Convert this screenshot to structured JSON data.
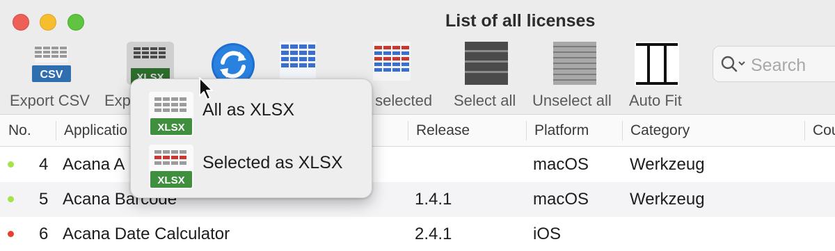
{
  "window": {
    "title": "List of all licenses"
  },
  "toolbar": {
    "export_csv": {
      "label": "Export CSV",
      "badge": "CSV"
    },
    "export_xlsx": {
      "label": "Exp",
      "badge": "XLSX"
    },
    "copy_selected": {
      "label": "y selected"
    },
    "select_all": {
      "label": "Select all"
    },
    "unselect_all": {
      "label": "Unselect all"
    },
    "auto_fit": {
      "label": "Auto Fit"
    },
    "search": {
      "placeholder": "Search"
    }
  },
  "table": {
    "headers": {
      "no": "No.",
      "application": "Applicatio",
      "release": "Release",
      "platform": "Platform",
      "category": "Category",
      "country": "Cou"
    },
    "rows": [
      {
        "status": "green",
        "no": "4",
        "application": "Acana A",
        "release": "",
        "platform": "macOS",
        "category": "Werkzeug"
      },
      {
        "status": "green",
        "no": "5",
        "application": "Acana Barcode",
        "release": "1.4.1",
        "platform": "macOS",
        "category": "Werkzeug"
      },
      {
        "status": "red",
        "no": "6",
        "application": "Acana Date Calculator",
        "release": "2.4.1",
        "platform": "iOS",
        "category": ""
      }
    ]
  },
  "menu": {
    "items": [
      {
        "label": "All as XLSX",
        "badge": "XLSX"
      },
      {
        "label": "Selected as XLSX",
        "badge": "XLSX"
      }
    ]
  },
  "colors": {
    "status_green": "#a6e34a",
    "status_red": "#e8402f",
    "xlsx_green": "#3f8f3f",
    "csv_blue": "#2f6fb0"
  }
}
